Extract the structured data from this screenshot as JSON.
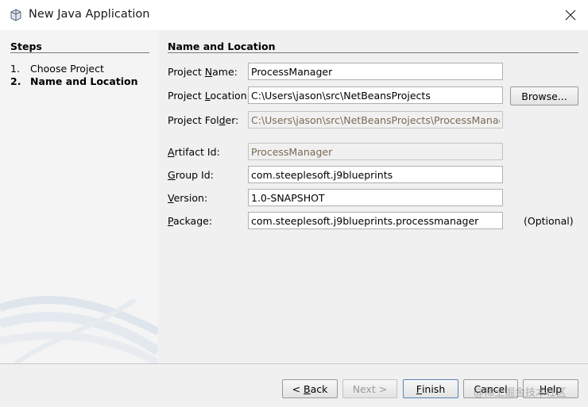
{
  "window": {
    "title": "New Java Application",
    "icon": "java-cup-icon"
  },
  "steps": {
    "header": "Steps",
    "items": [
      {
        "num": "1.",
        "label": "Choose Project"
      },
      {
        "num": "2.",
        "label": "Name and Location"
      }
    ]
  },
  "form": {
    "section_title": "Name and Location",
    "project_name": {
      "label_pre": "Project ",
      "label_key": "N",
      "label_post": "ame:",
      "value": "ProcessManager"
    },
    "project_location": {
      "label_pre": "Project ",
      "label_key": "L",
      "label_post": "ocation:",
      "value": "C:\\Users\\jason\\src\\NetBeansProjects"
    },
    "project_folder": {
      "label_pre": "Project Fol",
      "label_key": "d",
      "label_post": "er:",
      "value": "C:\\Users\\jason\\src\\NetBeansProjects\\ProcessManager"
    },
    "artifact_id": {
      "label_pre": "",
      "label_key": "A",
      "label_post": "rtifact Id:",
      "value": "ProcessManager"
    },
    "group_id": {
      "label_pre": "",
      "label_key": "G",
      "label_post": "roup Id:",
      "value": "com.steeplesoft.j9blueprints"
    },
    "version": {
      "label_pre": "",
      "label_key": "V",
      "label_post": "ersion:",
      "value": "1.0-SNAPSHOT"
    },
    "package": {
      "label_pre": "",
      "label_key": "P",
      "label_post": "ackage:",
      "value": "com.steeplesoft.j9blueprints.processmanager",
      "hint": "(Optional)"
    },
    "browse_label": "Browse..."
  },
  "buttons": {
    "back": {
      "prefix": "< ",
      "key": "B",
      "rest": "ack"
    },
    "next": "Next >",
    "finish": {
      "key": "F",
      "rest": "inish"
    },
    "cancel": "Cancel",
    "help": {
      "key": "H",
      "rest": "elp"
    }
  },
  "watermark": "@稀土掘金技术社区"
}
